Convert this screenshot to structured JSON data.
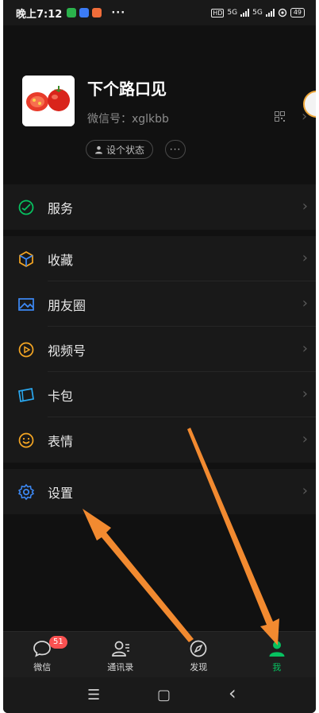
{
  "status_bar": {
    "time": "晚上7:12",
    "more": "···",
    "network1": "5G",
    "network2": "5G",
    "hd": "HD",
    "battery": "49"
  },
  "profile": {
    "nickname": "下个路口见",
    "wechat_id": "微信号：xglkbb",
    "set_status": "设个状态",
    "more": "···"
  },
  "menu": {
    "services": "服务",
    "favorites": "收藏",
    "moments": "朋友圈",
    "channels": "视频号",
    "cards": "卡包",
    "stickers": "表情",
    "settings": "设置"
  },
  "tabbar": {
    "chats": "微信",
    "chats_badge": "51",
    "contacts": "通讯录",
    "discover": "发现",
    "me": "我"
  },
  "nav": {
    "menu": "☰",
    "home": "▢",
    "back": "‹"
  },
  "colors": {
    "accent_green": "#07c160",
    "badge_red": "#fa5151",
    "annotation_orange": "#f28a30"
  }
}
